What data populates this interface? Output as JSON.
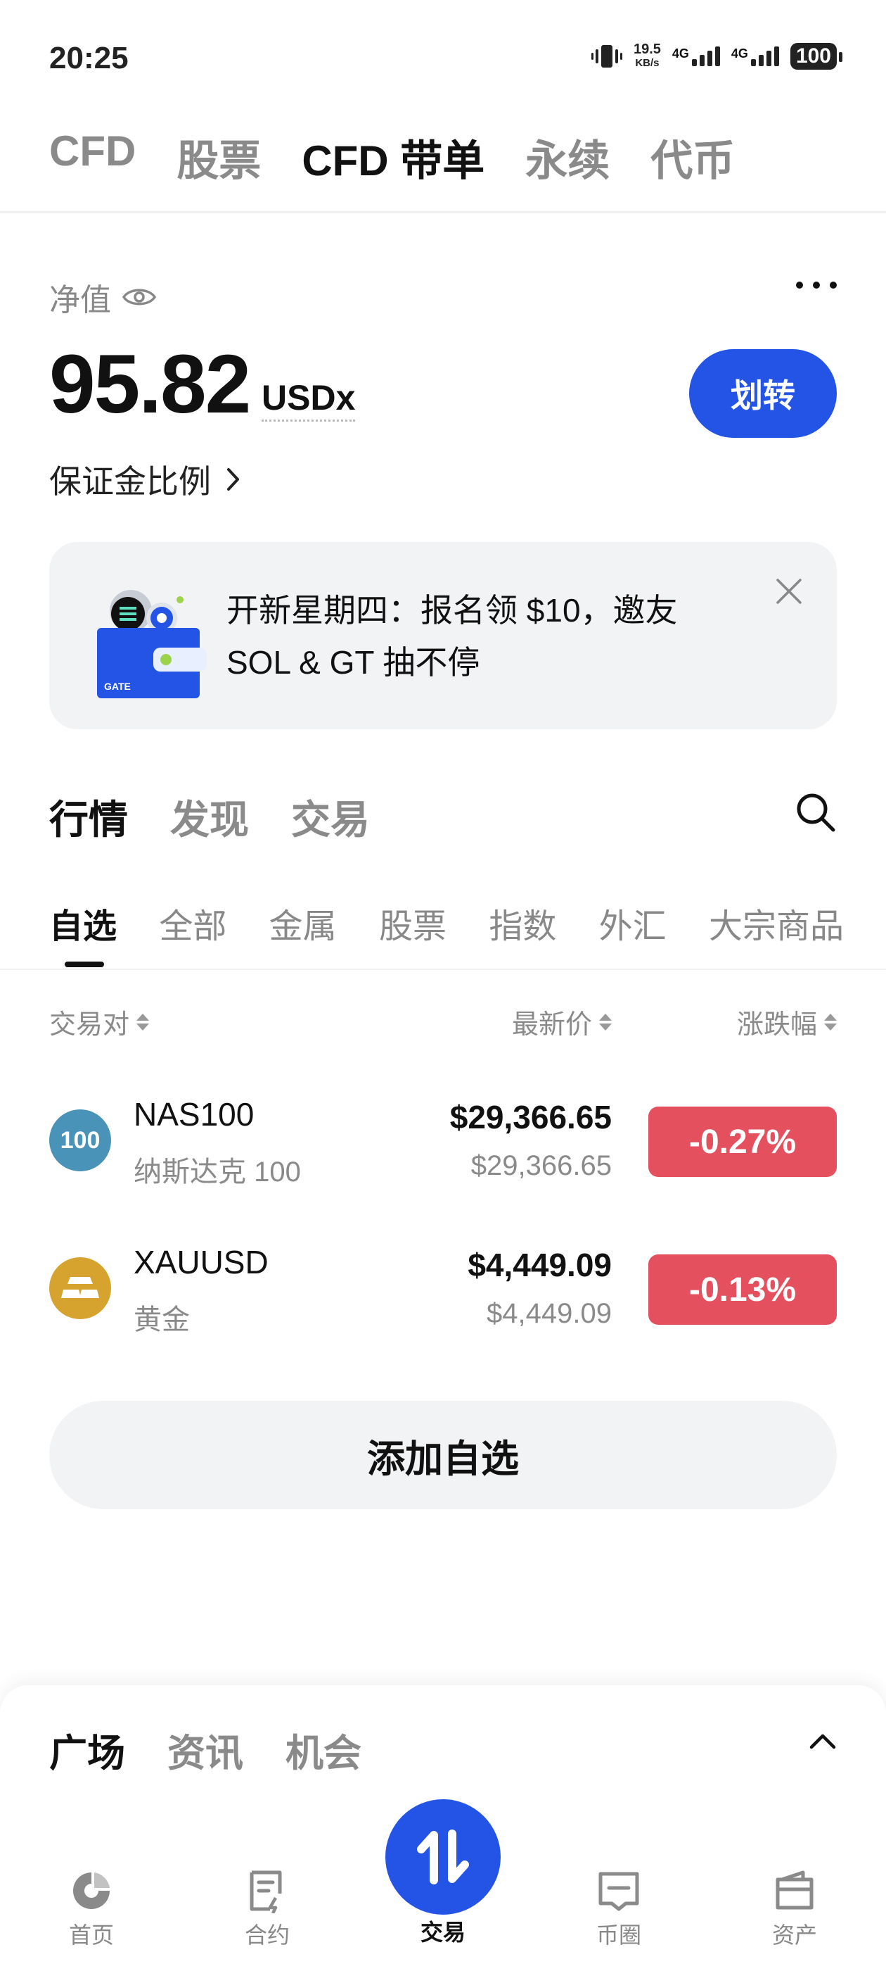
{
  "status_bar": {
    "time": "20:25",
    "speed_value": "19.5",
    "speed_unit": "KB/s",
    "net1": "4G",
    "net2": "4G",
    "battery": "100"
  },
  "top_tabs": [
    {
      "label": "CFD",
      "active": false
    },
    {
      "label": "股票",
      "active": false
    },
    {
      "label": "CFD 带单",
      "active": true
    },
    {
      "label": "永续",
      "active": false
    },
    {
      "label": "代币",
      "active": false
    }
  ],
  "account": {
    "nav_label": "净值",
    "nav_value": "95.82",
    "nav_unit": "USDx",
    "transfer_label": "划转",
    "margin_ratio_label": "保证金比例"
  },
  "banner": {
    "line1": "开新星期四：报名领 $10，邀友",
    "line2": "SOL & GT 抽不停",
    "logo_text": "GATE"
  },
  "section_tabs": [
    {
      "label": "行情",
      "active": true
    },
    {
      "label": "发现",
      "active": false
    },
    {
      "label": "交易",
      "active": false
    }
  ],
  "category_tabs": [
    {
      "label": "自选",
      "active": true
    },
    {
      "label": "全部",
      "active": false
    },
    {
      "label": "金属",
      "active": false
    },
    {
      "label": "股票",
      "active": false
    },
    {
      "label": "指数",
      "active": false
    },
    {
      "label": "外汇",
      "active": false
    },
    {
      "label": "大宗商品",
      "active": false
    }
  ],
  "columns": {
    "pair": "交易对",
    "price": "最新价",
    "change": "涨跌幅"
  },
  "rows": [
    {
      "symbol": "NAS100",
      "name": "纳斯达克 100",
      "icon_text": "100",
      "icon_color": "#4a93b8",
      "price": "$29,366.65",
      "price_sub": "$29,366.65",
      "change": "-0.27%"
    },
    {
      "symbol": "XAUUSD",
      "name": "黄金",
      "icon_text": "",
      "icon_color": "#d7a32f",
      "price": "$4,449.09",
      "price_sub": "$4,449.09",
      "change": "-0.13%"
    }
  ],
  "add_watchlist_label": "添加自选",
  "sheet_tabs": [
    {
      "label": "广场",
      "active": true
    },
    {
      "label": "资讯",
      "active": false
    },
    {
      "label": "机会",
      "active": false
    }
  ],
  "bottom_nav": [
    {
      "label": "首页",
      "icon": "home-icon"
    },
    {
      "label": "合约",
      "icon": "contract-icon"
    },
    {
      "label": "交易",
      "icon": "trade-icon",
      "active": true
    },
    {
      "label": "币圈",
      "icon": "community-icon"
    },
    {
      "label": "资产",
      "icon": "wallet-icon"
    }
  ],
  "colors": {
    "accent": "#2354e6",
    "negative": "#e5505f"
  }
}
